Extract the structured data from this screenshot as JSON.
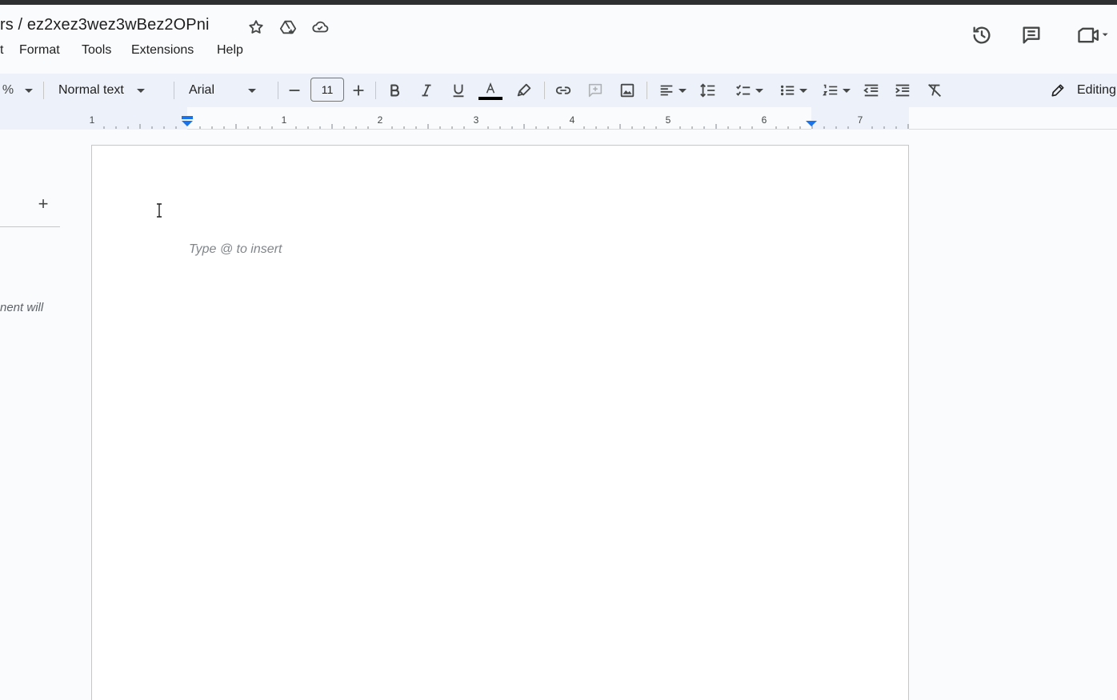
{
  "document": {
    "title": "rs / ez2xez3wez3wBez2OPni"
  },
  "menu": {
    "items": [
      {
        "label": "t"
      },
      {
        "label": "Format"
      },
      {
        "label": "Tools"
      },
      {
        "label": "Extensions"
      },
      {
        "label": "Help"
      }
    ]
  },
  "toolbar": {
    "zoom": "%",
    "paragraph_style": "Normal text",
    "font_family": "Arial",
    "font_size": "11",
    "mode_label": "Editing",
    "text_color": "#000000"
  },
  "ruler": {
    "labels": [
      "1",
      "1",
      "2",
      "3",
      "4",
      "5",
      "6",
      "7"
    ]
  },
  "side_panel": {
    "add_symbol": "+",
    "hint_fragment": "nent will"
  },
  "page": {
    "placeholder": "Type @ to insert"
  },
  "icons": {
    "title_bar": [
      "star-icon",
      "move-to-drive-icon",
      "cloud-saved-icon"
    ],
    "header": [
      "version-history-icon",
      "comments-icon",
      "meet-camera-icon"
    ]
  }
}
